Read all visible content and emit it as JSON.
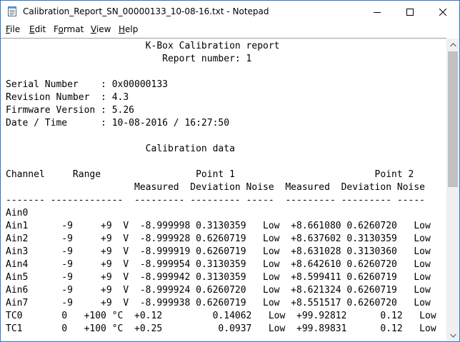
{
  "window": {
    "title": "Calibration_Report_SN_00000133_10-08-16.txt - Notepad"
  },
  "menu": [
    {
      "label": "File",
      "accel": "F",
      "rest": "ile"
    },
    {
      "label": "Edit",
      "accel": "E",
      "rest": "dit"
    },
    {
      "label": "Format",
      "accel": "F",
      "pre": "",
      "rest": "ormat",
      "accel_index": 1
    },
    {
      "label": "View",
      "accel": "V",
      "rest": "iew"
    },
    {
      "label": "Help",
      "accel": "H",
      "rest": "elp"
    }
  ],
  "document": {
    "lines": [
      "                         K-Box Calibration report",
      "                            Report number: 1",
      "",
      "Serial Number    : 0x00000133",
      "Revision Number  : 4.3",
      "Firmware Version : 5.26",
      "Date / Time      : 10-08-2016 / 16:27:50",
      "",
      "                         Calibration data",
      "",
      "Channel     Range                 Point 1                         Point 2",
      "                       Measured  Deviation Noise  Measured  Deviation Noise",
      "------- -------------  --------- --------- -----  --------- --------- -----",
      "Ain0",
      "Ain1      -9     +9  V  -8.999998 0.3130359   Low  +8.661080 0.6260720   Low",
      "Ain2      -9     +9  V  -8.999928 0.6260719   Low  +8.637602 0.3130359   Low",
      "Ain3      -9     +9  V  -8.999919 0.6260719   Low  +8.631028 0.3130360   Low",
      "Ain4      -9     +9  V  -8.999954 0.3130359   Low  +8.642610 0.6260720   Low",
      "Ain5      -9     +9  V  -8.999942 0.3130359   Low  +8.599411 0.6260719   Low",
      "Ain6      -9     +9  V  -8.999924 0.6260720   Low  +8.621324 0.6260719   Low",
      "Ain7      -9     +9  V  -8.999938 0.6260719   Low  +8.551517 0.6260720   Low",
      "TC0       0   +100 °C  +0.12         0.14062   Low  +99.92812      0.12   Low",
      "TC1       0   +100 °C  +0.25          0.0937   Low  +99.89831      0.12   Low"
    ]
  }
}
